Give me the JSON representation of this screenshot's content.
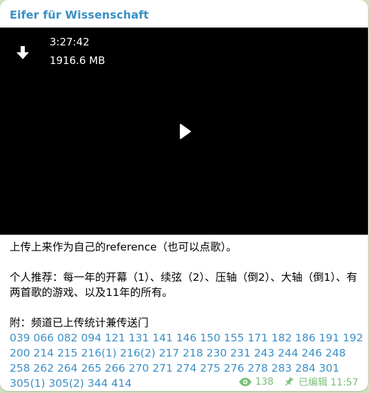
{
  "channel": {
    "name": "Eifer für Wissenschaft"
  },
  "video": {
    "duration": "3:27:42",
    "size": "1916.6 MB",
    "download_icon": "download-arrow-icon",
    "play_icon": "play-icon"
  },
  "caption": {
    "line1": "上传上来作为自己的reference（也可以点歌）。",
    "line2": "个人推荐：每一年的开幕（1）、续弦（2）、压轴（倒2）、大轴（倒1）、有两首歌的游戏、以及11年的所有。",
    "line3": "附：频道已上传统计兼传送门"
  },
  "links": [
    "039",
    "066",
    "082",
    "094",
    "121",
    "131",
    "141",
    "146",
    "150",
    "155",
    "171",
    "182",
    "186",
    "191",
    "192",
    "200",
    "214",
    "215",
    "216(1)",
    "216(2)",
    "217",
    "218",
    "230",
    "231",
    "243",
    "244",
    "246",
    "248",
    "258",
    "262",
    "264",
    "265",
    "266",
    "270",
    "271",
    "274",
    "275",
    "276",
    "278",
    "283",
    "284",
    "301",
    "305(1)",
    "305(2)",
    "344",
    "414"
  ],
  "footer": {
    "views": "138",
    "views_icon": "eye-icon",
    "pin_icon": "pin-icon",
    "edited": "已编辑 11:57"
  },
  "colors": {
    "accent": "#3a8fc6",
    "meta": "#7cbf7a",
    "video_bg": "#000000"
  }
}
